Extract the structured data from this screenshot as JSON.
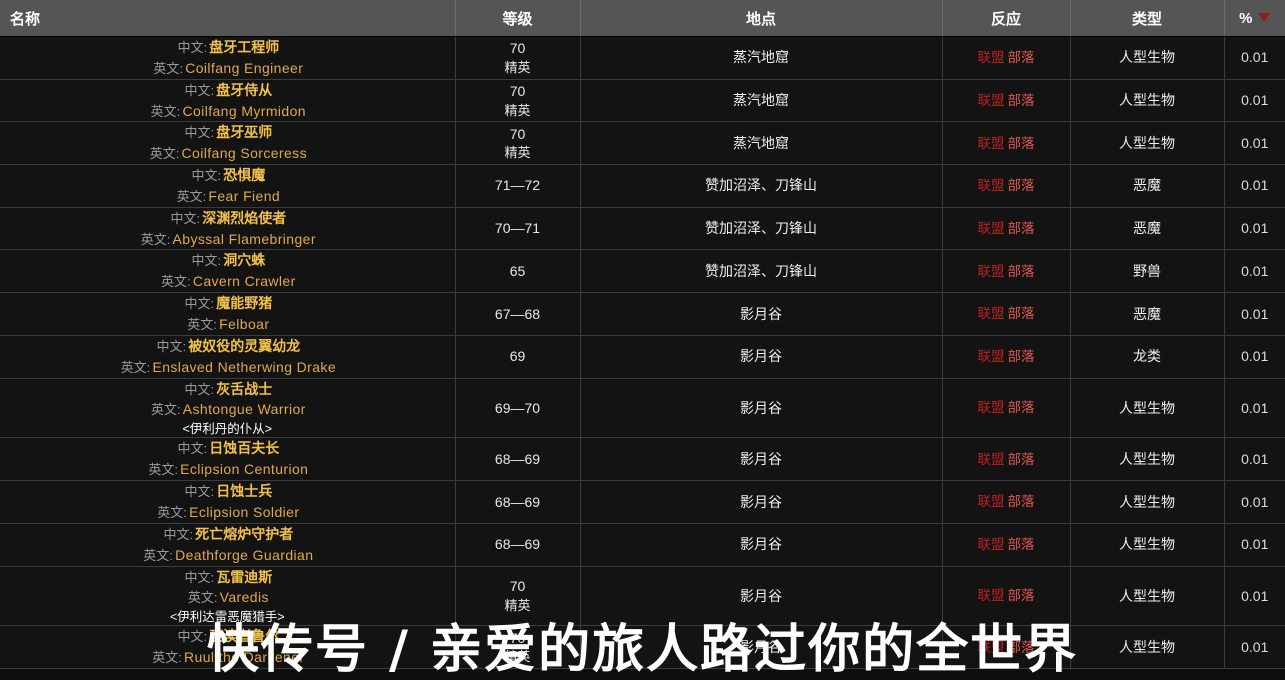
{
  "table": {
    "columns": [
      {
        "key": "name",
        "label": "名称"
      },
      {
        "key": "level",
        "label": "等级"
      },
      {
        "key": "location",
        "label": "地点"
      },
      {
        "key": "reaction",
        "label": "反应"
      },
      {
        "key": "type",
        "label": "类型"
      },
      {
        "key": "percent",
        "label": "%"
      }
    ],
    "sort": {
      "column": "percent",
      "direction": "desc",
      "caret_color": "#8e1c1c"
    },
    "labels": {
      "cn": "中文:",
      "en": "英文:",
      "elite": "精英"
    },
    "colors": {
      "header_bg": "#555555",
      "row_bg": "#131313",
      "row_border": "#3c3c3c",
      "name_cn": "#f2c14a",
      "name_en": "#e0a94a",
      "label_grey": "#9a9a9a",
      "alliance": "#c01f1f",
      "horde": "#e2574f"
    },
    "rows": [
      {
        "cn": "盘牙工程师",
        "en": "Coilfang Engineer",
        "sub": "",
        "level": "70",
        "elite": "精英",
        "location": "蒸汽地窟",
        "alliance": "联盟",
        "horde": "部落",
        "type": "人型生物",
        "percent": "0.01"
      },
      {
        "cn": "盘牙侍从",
        "en": "Coilfang Myrmidon",
        "sub": "",
        "level": "70",
        "elite": "精英",
        "location": "蒸汽地窟",
        "alliance": "联盟",
        "horde": "部落",
        "type": "人型生物",
        "percent": "0.01"
      },
      {
        "cn": "盘牙巫师",
        "en": "Coilfang Sorceress",
        "sub": "",
        "level": "70",
        "elite": "精英",
        "location": "蒸汽地窟",
        "alliance": "联盟",
        "horde": "部落",
        "type": "人型生物",
        "percent": "0.01"
      },
      {
        "cn": "恐惧魔",
        "en": "Fear Fiend",
        "sub": "",
        "level": "71—72",
        "elite": "",
        "location": "赞加沼泽、刀锋山",
        "alliance": "联盟",
        "horde": "部落",
        "type": "恶魔",
        "percent": "0.01"
      },
      {
        "cn": "深渊烈焰使者",
        "en": "Abyssal Flamebringer",
        "sub": "",
        "level": "70—71",
        "elite": "",
        "location": "赞加沼泽、刀锋山",
        "alliance": "联盟",
        "horde": "部落",
        "type": "恶魔",
        "percent": "0.01"
      },
      {
        "cn": "洞穴蛛",
        "en": "Cavern Crawler",
        "sub": "",
        "level": "65",
        "elite": "",
        "location": "赞加沼泽、刀锋山",
        "alliance": "联盟",
        "horde": "部落",
        "type": "野兽",
        "percent": "0.01"
      },
      {
        "cn": "魔能野猪",
        "en": "Felboar",
        "sub": "",
        "level": "67—68",
        "elite": "",
        "location": "影月谷",
        "alliance": "联盟",
        "horde": "部落",
        "type": "恶魔",
        "percent": "0.01"
      },
      {
        "cn": "被奴役的灵翼幼龙",
        "en": "Enslaved Netherwing Drake",
        "sub": "",
        "level": "69",
        "elite": "",
        "location": "影月谷",
        "alliance": "联盟",
        "horde": "部落",
        "type": "龙类",
        "percent": "0.01"
      },
      {
        "cn": "灰舌战士",
        "en": "Ashtongue Warrior",
        "sub": "<伊利丹的仆从>",
        "level": "69—70",
        "elite": "",
        "location": "影月谷",
        "alliance": "联盟",
        "horde": "部落",
        "type": "人型生物",
        "percent": "0.01"
      },
      {
        "cn": "日蚀百夫长",
        "en": "Eclipsion Centurion",
        "sub": "",
        "level": "68—69",
        "elite": "",
        "location": "影月谷",
        "alliance": "联盟",
        "horde": "部落",
        "type": "人型生物",
        "percent": "0.01"
      },
      {
        "cn": "日蚀士兵",
        "en": "Eclipsion Soldier",
        "sub": "",
        "level": "68—69",
        "elite": "",
        "location": "影月谷",
        "alliance": "联盟",
        "horde": "部落",
        "type": "人型生物",
        "percent": "0.01"
      },
      {
        "cn": "死亡熔炉守护者",
        "en": "Deathforge Guardian",
        "sub": "",
        "level": "68—69",
        "elite": "",
        "location": "影月谷",
        "alliance": "联盟",
        "horde": "部落",
        "type": "人型生物",
        "percent": "0.01"
      },
      {
        "cn": "瓦雷迪斯",
        "en": "Varedis",
        "sub": "<伊利达雷恶魔猎手>",
        "level": "70",
        "elite": "精英",
        "location": "影月谷",
        "alliance": "联盟",
        "horde": "部落",
        "type": "人型生物",
        "percent": "0.01"
      },
      {
        "cn": "亵渎者鲁尔",
        "en": "Ruul the Darkener",
        "sub": "",
        "level": "70",
        "elite": "精英",
        "location": "影月谷",
        "alliance": "联盟",
        "horde": "部落",
        "type": "人型生物",
        "percent": "0.01"
      }
    ]
  },
  "watermark": {
    "text": "快传号 / 亲爱的旅人路过你的全世界"
  }
}
